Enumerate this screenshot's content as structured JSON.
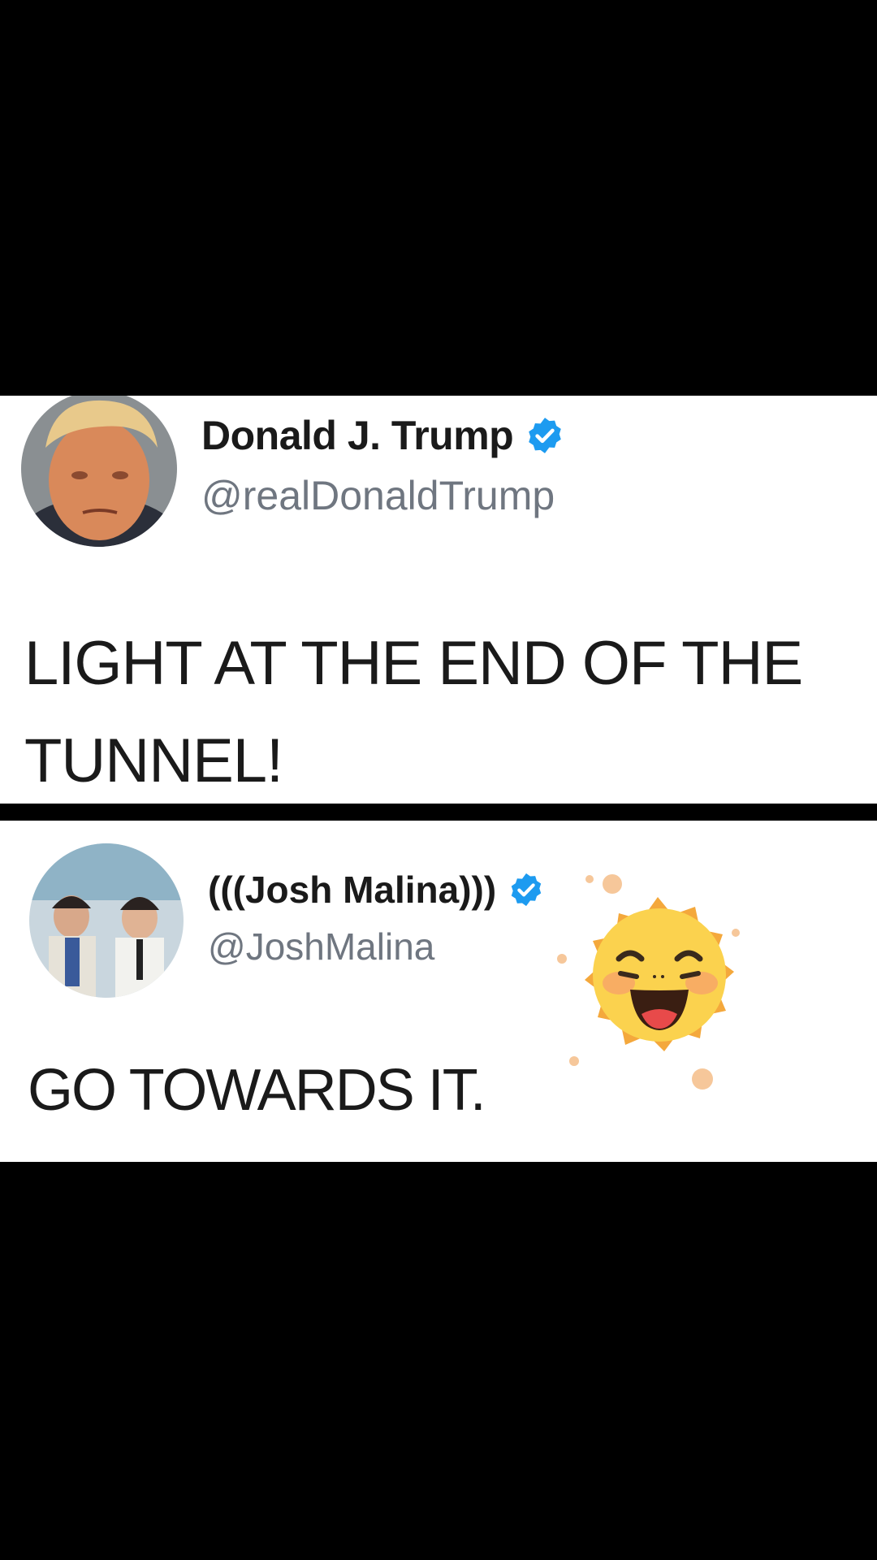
{
  "tweets": [
    {
      "display_name": "Donald J. Trump",
      "handle": "@realDonaldTrump",
      "verified": true,
      "text": "LIGHT AT THE END OF THE TUNNEL!"
    },
    {
      "display_name": "(((Josh Malina)))",
      "handle": "@JoshMalina",
      "verified": true,
      "text": "GO TOWARDS IT."
    }
  ],
  "colors": {
    "verified_badge": "#1d9bf0",
    "handle_gray": "#6f7680",
    "letterbox": "#000000",
    "card": "#ffffff"
  },
  "sticker": {
    "icon": "laughing-sun-sticker-icon"
  }
}
